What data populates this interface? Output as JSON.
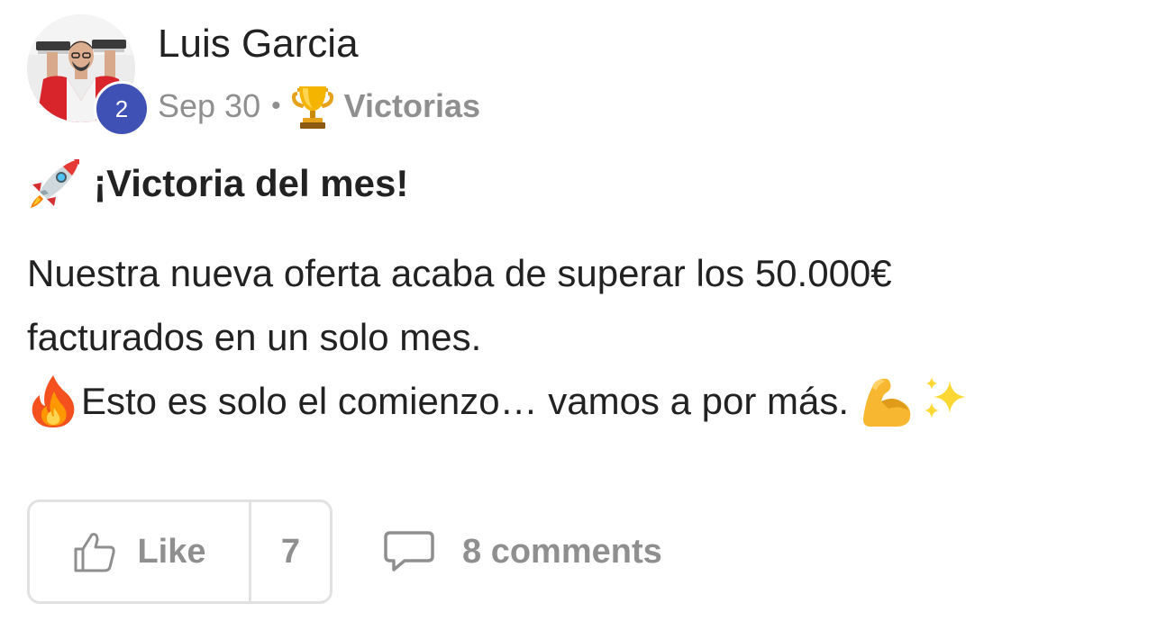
{
  "post": {
    "author": {
      "name": "Luis Garcia",
      "level": "2"
    },
    "meta": {
      "date": "Sep 30",
      "separator": "•",
      "category": "Victorias",
      "category_icon": "trophy-icon"
    },
    "title": {
      "icon": "rocket-icon",
      "text": "¡Victoria del mes!"
    },
    "body": {
      "line1": "Nuestra nueva oferta acaba de superar los 50.000€",
      "line2": "facturados en un solo mes.",
      "line3_icon": "fire-icon",
      "line3": "Esto es solo el comienzo… vamos a por más.",
      "line3_trailing_icons": [
        "flexed-biceps-icon",
        "sparkles-icon"
      ]
    },
    "actions": {
      "like_label": "Like",
      "like_count": "7",
      "comments_label": "8 comments"
    }
  },
  "colors": {
    "text": "#222222",
    "muted": "#8f8f8f",
    "badge": "#3f51b5",
    "border": "#e2e2e2"
  }
}
